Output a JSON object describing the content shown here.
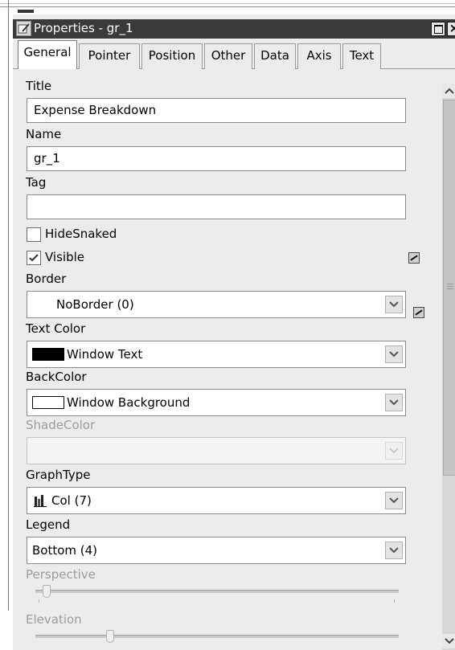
{
  "window": {
    "title": "Properties - gr_1"
  },
  "tabs": [
    "General",
    "Pointer",
    "Position",
    "Other",
    "Data",
    "Axis",
    "Text"
  ],
  "active_tab": "General",
  "general": {
    "title_label": "Title",
    "title_value": "Expense Breakdown",
    "name_label": "Name",
    "name_value": "gr_1",
    "tag_label": "Tag",
    "tag_value": "",
    "hidesnaked_label": "HideSnaked",
    "hidesnaked_checked": false,
    "visible_label": "Visible",
    "visible_checked": true,
    "border_label": "Border",
    "border_value": "NoBorder (0)",
    "textcolor_label": "Text Color",
    "textcolor_value": "Window Text",
    "textcolor_swatch": "#000000",
    "backcolor_label": "BackColor",
    "backcolor_value": "Window Background",
    "backcolor_swatch": "#ffffff",
    "shadecolor_label": "ShadeColor",
    "shadecolor_value": "",
    "graphtype_label": "GraphType",
    "graphtype_value": "Col (7)",
    "legend_label": "Legend",
    "legend_value": "Bottom (4)",
    "perspective_label": "Perspective",
    "perspective_level": 0.02,
    "elevation_label": "Elevation",
    "elevation_level": 0.2
  },
  "icons": {
    "window_icon": "properties-icon",
    "graphtype_icon": "column-chart-icon",
    "property_button": "expression-button-icon"
  }
}
